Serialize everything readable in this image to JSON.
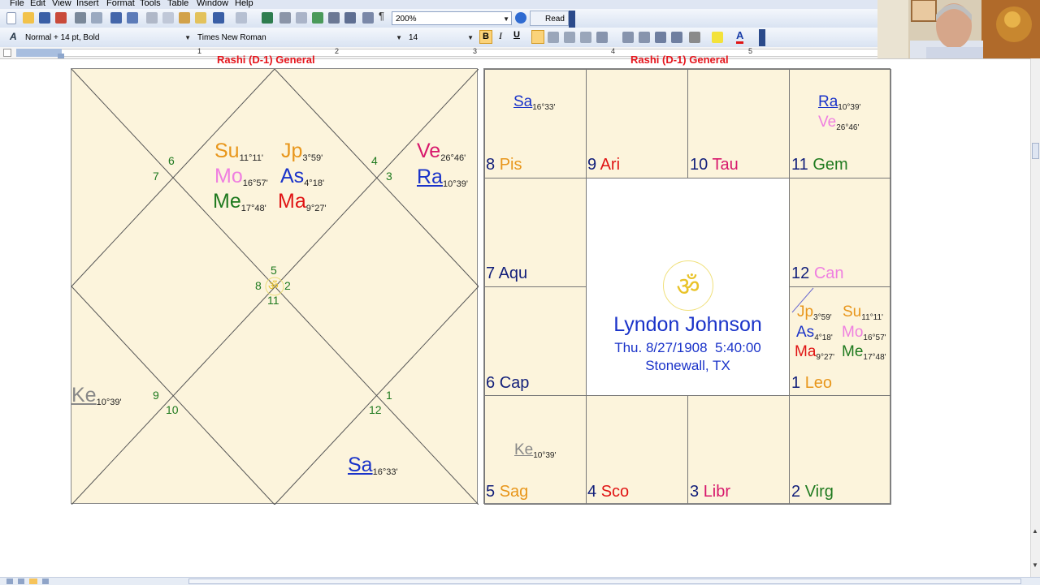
{
  "menu": [
    "File",
    "Edit",
    "View",
    "Insert",
    "Format",
    "Tools",
    "Table",
    "Window",
    "Help"
  ],
  "toolbar": {
    "zoom": "200%",
    "read_label": "Read",
    "style": "Normal + 14 pt, Bold",
    "font": "Times New Roman",
    "size": "14"
  },
  "ruler": [
    "1",
    "2",
    "3",
    "4",
    "5"
  ],
  "colors": {
    "page_bg": "#ffffff",
    "chart_bg": "#fcf4dc",
    "header_red": "#e5151c",
    "sign_num": "#121f7a",
    "house_green": "#1f7a1f",
    "orange": "#e8961b",
    "pink": "#ef7fe0",
    "blue": "#1a33c9",
    "green": "#1f7a1f",
    "red": "#e01414",
    "magenta": "#d7186c",
    "gray": "#888888"
  },
  "north_chart": {
    "header": "Rashi (D-1) General",
    "house_numbers": [
      "6",
      "7",
      "4",
      "3",
      "5",
      "8",
      "2",
      "11",
      "9",
      "10",
      "1",
      "12"
    ],
    "om": "ॐ",
    "planets": [
      {
        "name": "Su",
        "deg": "11°11'"
      },
      {
        "name": "Jp",
        "deg": "3°59'"
      },
      {
        "name": "Mo",
        "deg": "16°57'"
      },
      {
        "name": "As",
        "deg": "4°18'"
      },
      {
        "name": "Me",
        "deg": "17°48'"
      },
      {
        "name": "Ma",
        "deg": "9°27'"
      },
      {
        "name": "Ve",
        "deg": "26°46'"
      },
      {
        "name": "Ra",
        "deg": "10°39'"
      },
      {
        "name": "Ke",
        "deg": "10°39'"
      },
      {
        "name": "Sa",
        "deg": "16°33'"
      }
    ]
  },
  "south_chart": {
    "header": "Rashi (D-1) General",
    "signs": [
      {
        "num": "8",
        "name": "Pis"
      },
      {
        "num": "9",
        "name": "Ari"
      },
      {
        "num": "10",
        "name": "Tau"
      },
      {
        "num": "11",
        "name": "Gem"
      },
      {
        "num": "7",
        "name": "Aqu"
      },
      {
        "num": "12",
        "name": "Can"
      },
      {
        "num": "6",
        "name": "Cap"
      },
      {
        "num": "1",
        "name": "Leo"
      },
      {
        "num": "5",
        "name": "Sag"
      },
      {
        "num": "4",
        "name": "Sco"
      },
      {
        "num": "3",
        "name": "Libr"
      },
      {
        "num": "2",
        "name": "Virg"
      }
    ],
    "planets": {
      "sa": {
        "name": "Sa",
        "deg": "16°33'"
      },
      "ra": {
        "name": "Ra",
        "deg": "10°39'"
      },
      "ve": {
        "name": "Ve",
        "deg": "26°46'"
      },
      "jp": {
        "name": "Jp",
        "deg": "3°59'"
      },
      "su": {
        "name": "Su",
        "deg": "11°11'"
      },
      "as": {
        "name": "As",
        "deg": "4°18'"
      },
      "mo": {
        "name": "Mo",
        "deg": "16°57'"
      },
      "ma": {
        "name": "Ma",
        "deg": "9°27'"
      },
      "me": {
        "name": "Me",
        "deg": "17°48'"
      },
      "ke": {
        "name": "Ke",
        "deg": "10°39'"
      }
    },
    "center": {
      "om": "ॐ",
      "name": "Lyndon Johnson",
      "date": "Thu. 8/27/1908  5:40:00",
      "place": "Stonewall, TX"
    }
  }
}
